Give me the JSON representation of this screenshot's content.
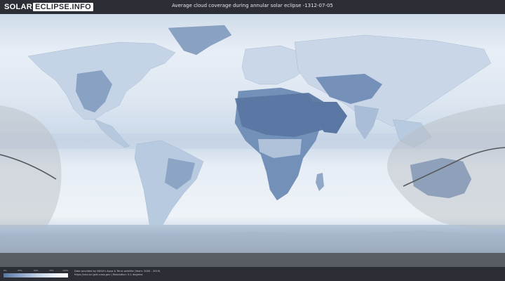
{
  "header": {
    "logo_part1": "SOLAR",
    "logo_part2": "ECLIPSE.INFO",
    "title": "Average cloud coverage during annular solar eclipse -1312-07-05"
  },
  "legend": {
    "ticks": [
      "0%",
      "25%",
      "50%",
      "75%",
      "100%"
    ],
    "colors": [
      "#5a77a3",
      "#8aa4c6",
      "#bccde2",
      "#e4ecf5",
      "#ffffff"
    ]
  },
  "credits": {
    "line1": "Data provided by NASA's Aqua & Terra satellite (Years: 2000 - 2019)",
    "line2": "https://neo.sci.gsfc.nasa.gov | Resolution: 0.1 degrees"
  },
  "map": {
    "ocean_color": "#dfe8f2",
    "land_dark_color": "#5d79a4",
    "eclipse_zone_color": "#b9bcc0",
    "eclipse_path_color": "#55585d"
  }
}
